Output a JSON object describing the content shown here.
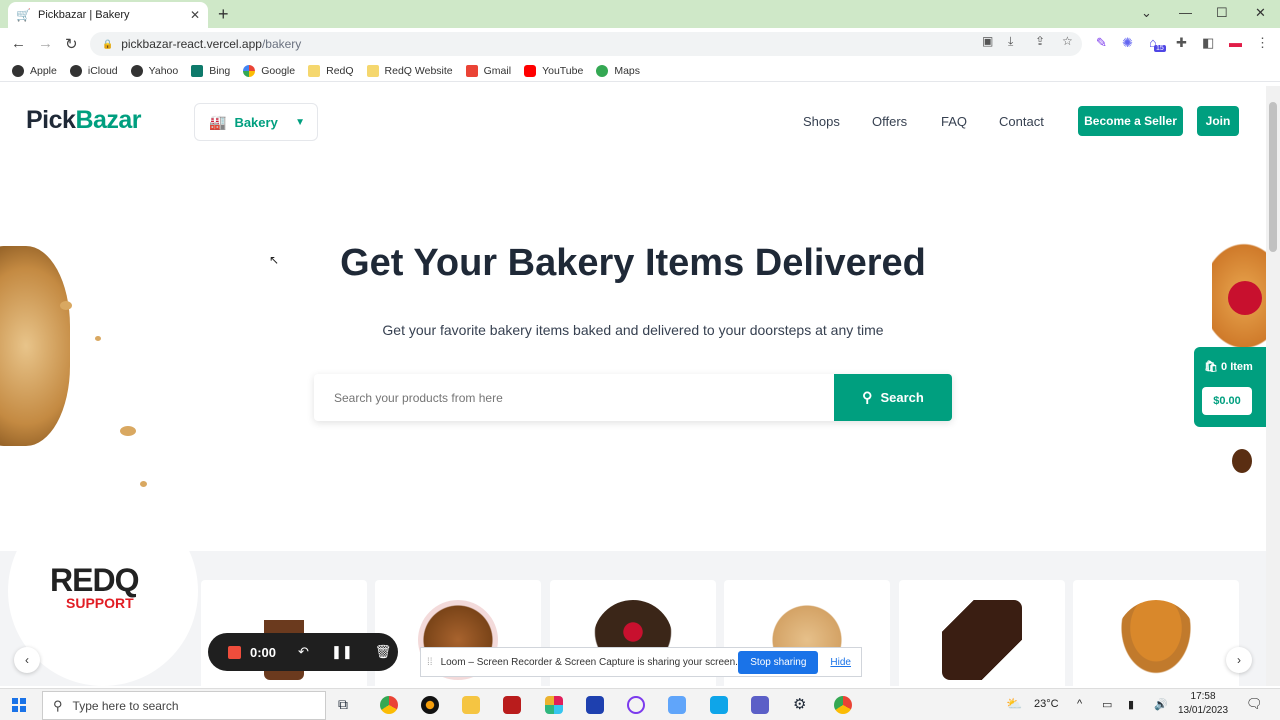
{
  "browser": {
    "tab_title": "Pickbazar | Bakery",
    "new_tab": "+",
    "url_host": "pickbazar-react.vercel.app",
    "url_path": "/bakery",
    "bookmarks": [
      "Apple",
      "iCloud",
      "Yahoo",
      "Bing",
      "Google",
      "RedQ",
      "RedQ Website",
      "Gmail",
      "YouTube",
      "Maps"
    ],
    "extension_badge": "15"
  },
  "header": {
    "logo_first": "Pick",
    "logo_second": "Bazar",
    "category": "Bakery",
    "nav": [
      "Shops",
      "Offers",
      "FAQ",
      "Contact"
    ],
    "become_seller": "Become a Seller",
    "join": "Join"
  },
  "hero": {
    "title": "Get Your Bakery Items Delivered",
    "subtitle": "Get your favorite bakery items baked and delivered to your doorsteps at any time",
    "search_placeholder": "Search your products from here",
    "search_button": "Search"
  },
  "cart": {
    "items_label": "0 Item",
    "total": "$0.00"
  },
  "promo": {
    "brand": "REDQ",
    "tag": "SUPPORT"
  },
  "loom": {
    "time": "0:00",
    "share_message": "Loom – Screen Recorder & Screen Capture is sharing your screen.",
    "stop_sharing": "Stop sharing",
    "hide": "Hide"
  },
  "taskbar": {
    "search_placeholder": "Type here to search",
    "temperature": "23°C",
    "time": "17:58",
    "date": "13/01/2023"
  },
  "colors": {
    "brand": "#009f7f",
    "tab_bar": "#cfe8c8",
    "loom_stop": "#1a73e8"
  }
}
